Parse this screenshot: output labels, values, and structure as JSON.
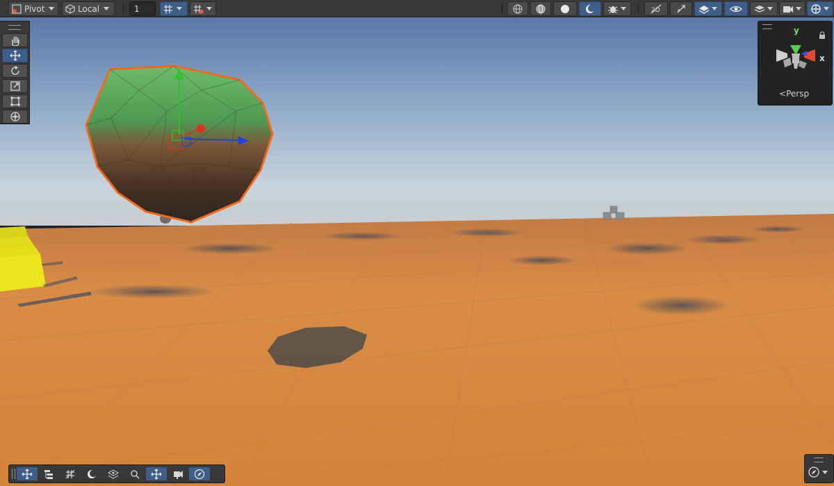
{
  "toolbar": {
    "pivot_label": "Pivot",
    "local_label": "Local",
    "grid_snap_value": "1"
  },
  "gizmo": {
    "axis_y": "y",
    "axis_x": "x",
    "projection_label": "Persp"
  },
  "scene_tools": [
    "View",
    "Move",
    "Rotate",
    "Scale",
    "Rect",
    "Transform"
  ],
  "icons": {
    "pivot": "pivot-icon",
    "local": "local-cube-icon",
    "grid_snap": "grid-snap-icon",
    "increment_snap": "increment-snap-icon",
    "wireframe": "wireframe-shading-icon",
    "shaded_wireframe": "shaded-wireframe-icon",
    "unlit": "unlit-shading-icon",
    "shaded": "shaded-icon",
    "debug": "debug-draw-icon",
    "2d": "2d-toggle-icon",
    "lighting": "lighting-toggle-icon",
    "effects": "effects-icon",
    "visibility": "visibility-eye-icon",
    "layers": "layers-icon",
    "camera": "camera-icon",
    "gizmos": "gizmos-icon"
  },
  "colors": {
    "toolbar_bg": "#383838",
    "active_blue": "#3e5f8a",
    "sky_top": "#5c7aa8",
    "ground": "#d4883e",
    "selection_outline": "#f06a1e",
    "axis_x": "#e03020",
    "axis_y": "#30c030",
    "axis_z": "#2040e0",
    "yellow_object": "#e4dd18"
  }
}
